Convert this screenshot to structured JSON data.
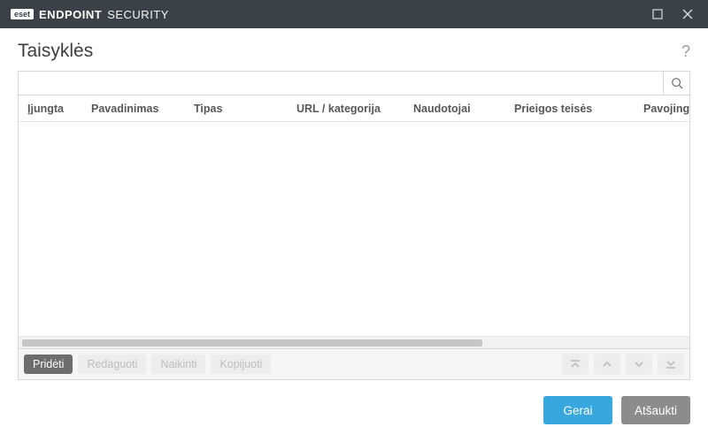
{
  "window": {
    "brand_logo": "eset",
    "brand_strong": "ENDPOINT",
    "brand_light": "SECURITY"
  },
  "page": {
    "title": "Taisyklės",
    "help": "?"
  },
  "search": {
    "value": "",
    "placeholder": ""
  },
  "columns": {
    "c0": "Įjungta",
    "c1": "Pavadinimas",
    "c2": "Tipas",
    "c3": "URL / kategorija",
    "c4": "Naudotojai",
    "c5": "Prieigos teisės",
    "c6": "Pavojingumas"
  },
  "toolbar": {
    "add": "Pridėti",
    "edit": "Redaguoti",
    "delete": "Naikinti",
    "copy": "Kopijuoti"
  },
  "footer": {
    "ok": "Gerai",
    "cancel": "Atšaukti"
  }
}
